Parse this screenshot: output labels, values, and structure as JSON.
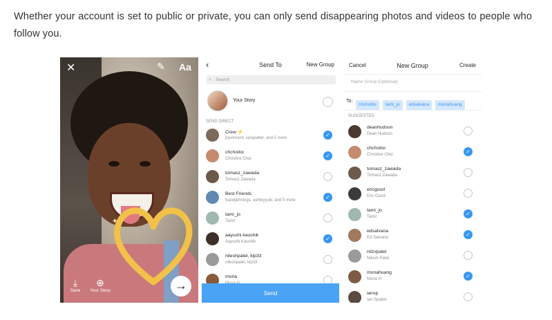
{
  "intro_text": "Whether your account is set to public or private, you can only send disappearing photos and videos to people who follow you.",
  "camera": {
    "close_icon": "close-icon",
    "pen_icon": "pen-icon",
    "text_tool": "Aa",
    "save_label": "Save",
    "your_story_label": "Your Story",
    "next_icon": "arrow-right-icon"
  },
  "send_to": {
    "title": "Send To",
    "new_group": "New Group",
    "search_placeholder": "Search",
    "your_story": "Your Story",
    "section_label": "SEND DIRECT",
    "rows": [
      {
        "name": "Crew ⚡",
        "sub": "joyvincent, ianspalter, and 5 more",
        "checked": true,
        "color": "#7c6a5c"
      },
      {
        "name": "chchoitoi",
        "sub": "Christine Choi",
        "checked": true,
        "color": "#c48b6e"
      },
      {
        "name": "tomasz_zawada",
        "sub": "Tomasz Zawada",
        "checked": false,
        "color": "#6e5a4b"
      },
      {
        "name": "Best Friends",
        "sub": "hazeljennings, ashleyyuki, and 5 more",
        "checked": true,
        "color": "#5f89b3"
      },
      {
        "name": "tami_jo",
        "sub": "Tami!",
        "checked": false,
        "color": "#9fb8b0"
      },
      {
        "name": "aayushi.kaushik",
        "sub": "Aayushi Kaushik",
        "checked": true,
        "color": "#3e2f28"
      },
      {
        "name": "nileshpatel, klp33",
        "sub": "nileshpatel, klp33",
        "checked": false,
        "color": "#9a9a9a"
      },
      {
        "name": "mona",
        "sub": "Mona H",
        "checked": false,
        "color": "#8a5a3c"
      }
    ],
    "send_label": "Send"
  },
  "new_group": {
    "cancel": "Cancel",
    "title": "New Group",
    "create": "Create",
    "name_placeholder": "Name Group (Optional)",
    "to_label": "To:",
    "chips": [
      "chchoitoi",
      "tami_jo",
      "edsalvana",
      "monahuang"
    ],
    "section_label": "SUGGESTED",
    "rows": [
      {
        "name": "deanhudson",
        "sub": "Dean Hudson",
        "checked": false,
        "color": "#4a3a30"
      },
      {
        "name": "chchoitoi",
        "sub": "Christine Choi",
        "checked": true,
        "color": "#c48b6e"
      },
      {
        "name": "tomasz_zawada",
        "sub": "Tomasz Zawada",
        "checked": false,
        "color": "#6e5a4b"
      },
      {
        "name": "ericgoud",
        "sub": "Eric Goud",
        "checked": false,
        "color": "#3b3b3b"
      },
      {
        "name": "tami_jo",
        "sub": "Tami!",
        "checked": true,
        "color": "#9fb8b0"
      },
      {
        "name": "edsalvana",
        "sub": "Ed Salvana",
        "checked": true,
        "color": "#a07a5e"
      },
      {
        "name": "nilzvpatel",
        "sub": "Nilesh Patel",
        "checked": false,
        "color": "#9a9a9a"
      },
      {
        "name": "monahuang",
        "sub": "Mona H",
        "checked": true,
        "color": "#7c5a45"
      },
      {
        "name": "iansp",
        "sub": "Ian Spalter",
        "checked": false,
        "color": "#5a4a40"
      }
    ]
  }
}
